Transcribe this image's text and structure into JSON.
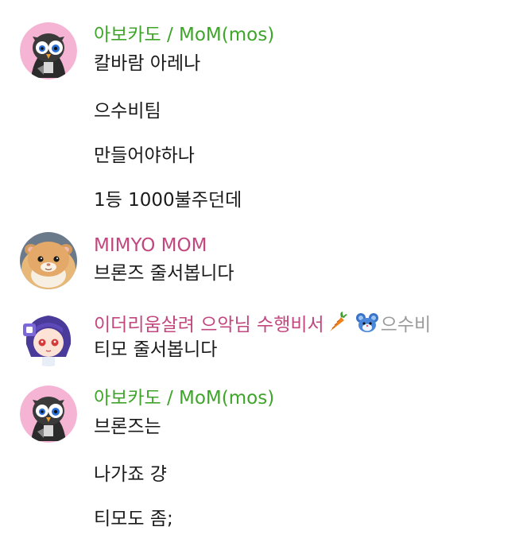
{
  "colors": {
    "green_name": "#3fa52a",
    "pink_name": "#c2477e",
    "text": "#1a1a1a",
    "muted": "#9b9b9b"
  },
  "messages": [
    {
      "sender": "아보카도 / MoM(mos)",
      "avatar_icon": "owl-avatar-icon",
      "lines": [
        "칼바람 아레나",
        "으수비팀",
        "만들어야하나",
        "1등 1000불주던데"
      ]
    },
    {
      "sender": "MIMYO MOM",
      "avatar_icon": "hamster-avatar-icon",
      "lines": [
        "브론즈 줄서봅니다"
      ]
    },
    {
      "sender": "이더리움살려 으악님 수행비서",
      "sender_suffix": "으수비",
      "badge_icons": [
        "carrot-icon",
        "mouse-icon"
      ],
      "avatar_icon": "anime-girl-avatar-icon",
      "lines": [
        "티모 줄서봅니다"
      ]
    },
    {
      "sender": "아보카도 / MoM(mos)",
      "avatar_icon": "owl-avatar-icon",
      "lines": [
        "브론즈는",
        "나가죠 걍",
        "티모도 좀;"
      ]
    }
  ]
}
